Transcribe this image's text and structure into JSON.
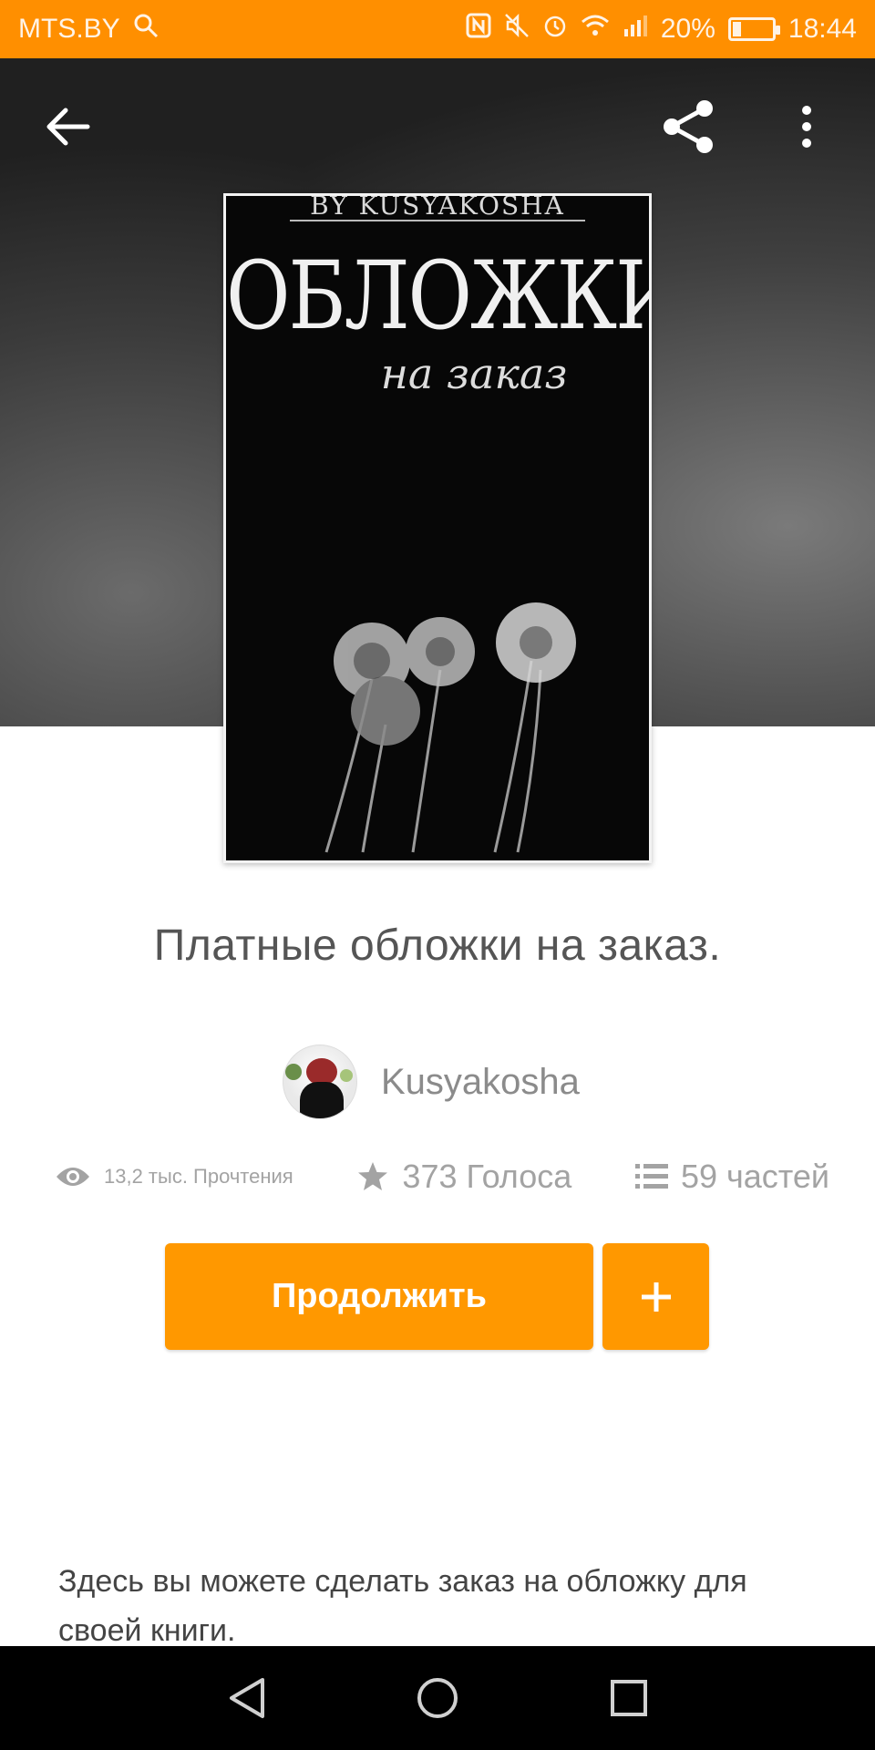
{
  "status_bar": {
    "carrier": "MTS.BY",
    "battery_percent": "20%",
    "battery_level": 0.2,
    "time": "18:44",
    "icons": [
      "search-icon",
      "nfc-icon",
      "mute-icon",
      "alarm-icon",
      "wifi-icon",
      "signal-icon",
      "battery-icon"
    ]
  },
  "toolbar": {
    "icons": [
      "back-arrow-icon",
      "share-icon",
      "more-vert-icon"
    ]
  },
  "cover": {
    "byline": "BY KUSYAKOSHA",
    "title_line1": "ОБЛОЖКИ",
    "title_line2": "на заказ"
  },
  "book": {
    "title": "Платные обложки на заказ.",
    "author": "Kusyakosha",
    "reads": "13,2 тыс. Прочтения",
    "votes": "373 Голоса",
    "parts": "59 частей",
    "description": "Здесь вы можете сделать заказ на обложку для своей книги."
  },
  "actions": {
    "continue_label": "Продолжить",
    "add_icon": "plus-icon"
  },
  "colors": {
    "accent": "#ff9800",
    "status_bar": "#ff8f00"
  },
  "nav_bar": {
    "icons": [
      "back-triangle-icon",
      "home-circle-icon",
      "recents-square-icon"
    ]
  }
}
